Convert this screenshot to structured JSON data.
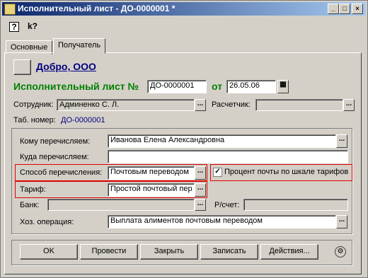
{
  "window": {
    "title": "Исполнительный лист - ДО-0000001 *"
  },
  "toolbar": {
    "help_icon": "?",
    "whats_this_icon": "k?"
  },
  "tabs": [
    {
      "label": "Основные"
    },
    {
      "label": "Получатель"
    }
  ],
  "org": {
    "name": "Добро, ООО"
  },
  "doc": {
    "title": "Исполнительный лист №",
    "number": "ДО-0000001",
    "date_label": "от",
    "date": "26.05.06"
  },
  "employee": {
    "label": "Сотрудник:",
    "value": "Админенко С. Л."
  },
  "accountant": {
    "label": "Расчетчик:",
    "value": ""
  },
  "tab_number": {
    "label": "Таб. номер:",
    "value": "ДО-0000001"
  },
  "payee": {
    "label": "Кому перечисляем:",
    "value": "Иванова Елена Александровна"
  },
  "where": {
    "label": "Куда перечисляем:",
    "value": ""
  },
  "method": {
    "label": "Способ перечисления:",
    "value": "Почтовым переводом"
  },
  "percent": {
    "label": "Процент почты по шкале тарифов",
    "checked": true
  },
  "tariff": {
    "label": "Тариф:",
    "value": "Простой почтовый пер"
  },
  "bank": {
    "label": "Банк:",
    "value": ""
  },
  "account": {
    "label": "Р/счет:",
    "value": ""
  },
  "operation": {
    "label": "Хоз. операция:",
    "value": "Выплата алиментов почтовым переводом"
  },
  "buttons": {
    "ok": "OK",
    "post": "Провести",
    "close": "Закрыть",
    "save": "Записать",
    "actions": "Действия..."
  },
  "colors": {
    "title_start": "#0a246a",
    "title_end": "#a6caf0",
    "highlight": "#e00000",
    "doc_title": "#008000",
    "link": "#000080"
  }
}
